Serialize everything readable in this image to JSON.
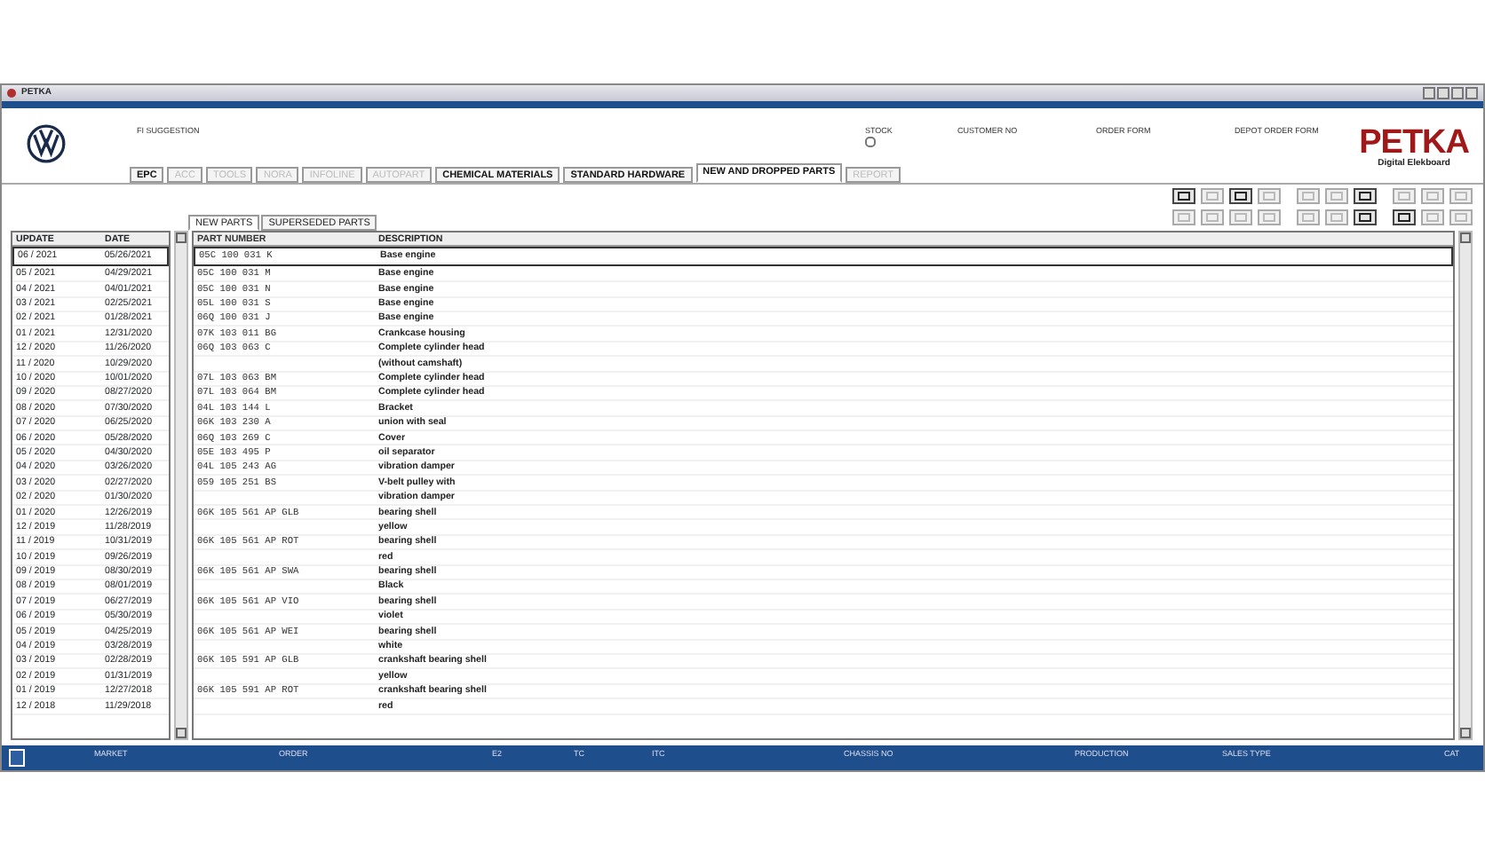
{
  "window": {
    "title": "PETKA"
  },
  "header": {
    "suggestion_label": "FI SUGGESTION",
    "stock": {
      "label": "STOCK",
      "checked": false
    },
    "customer_no": "CUSTOMER NO",
    "order_form": "ORDER FORM",
    "depot_order_form": "DEPOT ORDER FORM",
    "logo": {
      "name": "PETKA",
      "subtitle": "Digital Elekboard"
    }
  },
  "tabs": [
    {
      "label": "EPC",
      "selected": false,
      "disabled": false
    },
    {
      "label": "ACC",
      "selected": false,
      "disabled": true
    },
    {
      "label": "TOOLS",
      "selected": false,
      "disabled": true
    },
    {
      "label": "NORA",
      "selected": false,
      "disabled": true
    },
    {
      "label": "INFOLINE",
      "selected": false,
      "disabled": true
    },
    {
      "label": "AUTOPART",
      "selected": false,
      "disabled": true
    },
    {
      "label": "CHEMICAL MATERIALS",
      "selected": false,
      "disabled": false
    },
    {
      "label": "STANDARD HARDWARE",
      "selected": false,
      "disabled": false
    },
    {
      "label": "NEW AND DROPPED PARTS",
      "selected": true,
      "disabled": false
    },
    {
      "label": "REPORT",
      "selected": false,
      "disabled": true
    }
  ],
  "toolbar": [
    [
      {
        "disabled": false
      },
      {
        "disabled": true
      },
      {
        "disabled": false
      },
      {
        "disabled": true
      },
      {
        "disabled": true
      },
      {
        "disabled": true
      },
      {
        "disabled": false
      },
      {
        "disabled": true
      },
      {
        "disabled": true
      },
      {
        "disabled": true
      }
    ],
    [
      {
        "disabled": true
      },
      {
        "disabled": true
      },
      {
        "disabled": true
      },
      {
        "disabled": true
      },
      {
        "disabled": true
      },
      {
        "disabled": true
      },
      {
        "disabled": false
      },
      {
        "disabled": false
      },
      {
        "disabled": true
      },
      {
        "disabled": true
      }
    ]
  ],
  "sub_tabs": [
    {
      "label": "NEW PARTS",
      "selected": true
    },
    {
      "label": "SUPERSEDED PARTS",
      "selected": false
    }
  ],
  "updates": {
    "columns": [
      "UPDATE",
      "DATE"
    ],
    "rows": [
      {
        "update": "06 / 2021",
        "date": "05/26/2021",
        "selected": true
      },
      {
        "update": "05 / 2021",
        "date": "04/29/2021",
        "selected": false
      },
      {
        "update": "04 / 2021",
        "date": "04/01/2021",
        "selected": false
      },
      {
        "update": "03 / 2021",
        "date": "02/25/2021",
        "selected": false
      },
      {
        "update": "02 / 2021",
        "date": "01/28/2021",
        "selected": false
      },
      {
        "update": "01 / 2021",
        "date": "12/31/2020",
        "selected": false
      },
      {
        "update": "12 / 2020",
        "date": "11/26/2020",
        "selected": false
      },
      {
        "update": "11 / 2020",
        "date": "10/29/2020",
        "selected": false
      },
      {
        "update": "10 / 2020",
        "date": "10/01/2020",
        "selected": false
      },
      {
        "update": "09 / 2020",
        "date": "08/27/2020",
        "selected": false
      },
      {
        "update": "08 / 2020",
        "date": "07/30/2020",
        "selected": false
      },
      {
        "update": "07 / 2020",
        "date": "06/25/2020",
        "selected": false
      },
      {
        "update": "06 / 2020",
        "date": "05/28/2020",
        "selected": false
      },
      {
        "update": "05 / 2020",
        "date": "04/30/2020",
        "selected": false
      },
      {
        "update": "04 / 2020",
        "date": "03/26/2020",
        "selected": false
      },
      {
        "update": "03 / 2020",
        "date": "02/27/2020",
        "selected": false
      },
      {
        "update": "02 / 2020",
        "date": "01/30/2020",
        "selected": false
      },
      {
        "update": "01 / 2020",
        "date": "12/26/2019",
        "selected": false
      },
      {
        "update": "12 / 2019",
        "date": "11/28/2019",
        "selected": false
      },
      {
        "update": "11 / 2019",
        "date": "10/31/2019",
        "selected": false
      },
      {
        "update": "10 / 2019",
        "date": "09/26/2019",
        "selected": false
      },
      {
        "update": "09 / 2019",
        "date": "08/30/2019",
        "selected": false
      },
      {
        "update": "08 / 2019",
        "date": "08/01/2019",
        "selected": false
      },
      {
        "update": "07 / 2019",
        "date": "06/27/2019",
        "selected": false
      },
      {
        "update": "06 / 2019",
        "date": "05/30/2019",
        "selected": false
      },
      {
        "update": "05 / 2019",
        "date": "04/25/2019",
        "selected": false
      },
      {
        "update": "04 / 2019",
        "date": "03/28/2019",
        "selected": false
      },
      {
        "update": "03 / 2019",
        "date": "02/28/2019",
        "selected": false
      },
      {
        "update": "02 / 2019",
        "date": "01/31/2019",
        "selected": false
      },
      {
        "update": "01 / 2019",
        "date": "12/27/2018",
        "selected": false
      },
      {
        "update": "12 / 2018",
        "date": "11/29/2018",
        "selected": false
      }
    ]
  },
  "parts": {
    "columns": [
      "PART NUMBER",
      "DESCRIPTION"
    ],
    "rows": [
      {
        "part_number": "05C 100 031 K",
        "description": "Base engine",
        "selected": true
      },
      {
        "part_number": "05C 100 031 M",
        "description": "Base engine",
        "selected": false
      },
      {
        "part_number": "05C 100 031 N",
        "description": "Base engine",
        "selected": false
      },
      {
        "part_number": "05L 100 031 S",
        "description": "Base engine",
        "selected": false
      },
      {
        "part_number": "06Q 100 031 J",
        "description": "Base engine",
        "selected": false
      },
      {
        "part_number": "07K 103 011 BG",
        "description": "Crankcase housing",
        "selected": false
      },
      {
        "part_number": "06Q 103 063 C",
        "description": "Complete cylinder head",
        "selected": false
      },
      {
        "description": "(without camshaft)",
        "selected": false
      },
      {
        "part_number": "07L 103 063 BM",
        "description": "Complete cylinder head",
        "selected": false
      },
      {
        "part_number": "07L 103 064 BM",
        "description": "Complete cylinder head",
        "selected": false
      },
      {
        "part_number": "04L 103 144 L",
        "description": "Bracket",
        "selected": false
      },
      {
        "part_number": "06K 103 230 A",
        "description": "union with seal",
        "selected": false
      },
      {
        "part_number": "06Q 103 269 C",
        "description": "Cover",
        "selected": false
      },
      {
        "part_number": "05E 103 495 P",
        "description": "oil separator",
        "selected": false
      },
      {
        "part_number": "04L 105 243 AG",
        "description": "vibration damper",
        "selected": false
      },
      {
        "part_number": "059 105 251 BS",
        "description": "V-belt pulley with",
        "selected": false
      },
      {
        "description": "vibration damper",
        "selected": false
      },
      {
        "part_number": "06K 105 561 AP GLB",
        "description": "bearing shell",
        "selected": false
      },
      {
        "description": "yellow",
        "selected": false
      },
      {
        "part_number": "06K 105 561 AP ROT",
        "description": "bearing shell",
        "selected": false
      },
      {
        "description": "red",
        "selected": false
      },
      {
        "part_number": "06K 105 561 AP SWA",
        "description": "bearing shell",
        "selected": false
      },
      {
        "description": "Black",
        "selected": false
      },
      {
        "part_number": "06K 105 561 AP VIO",
        "description": "bearing shell",
        "selected": false
      },
      {
        "description": "violet",
        "selected": false
      },
      {
        "part_number": "06K 105 561 AP WEI",
        "description": "bearing shell",
        "selected": false
      },
      {
        "description": "white",
        "selected": false
      },
      {
        "part_number": "06K 105 591 AP GLB",
        "description": "crankshaft bearing shell",
        "selected": false
      },
      {
        "description": "yellow",
        "selected": false
      },
      {
        "part_number": "06K 105 591 AP ROT",
        "description": "crankshaft bearing shell",
        "selected": false
      },
      {
        "description": "red",
        "selected": false
      }
    ]
  },
  "status_bar": [
    "MARKET",
    "ORDER",
    "E2",
    "TC",
    "ITC",
    "CHASSIS NO",
    "PRODUCTION",
    "SALES TYPE",
    "CAT"
  ]
}
